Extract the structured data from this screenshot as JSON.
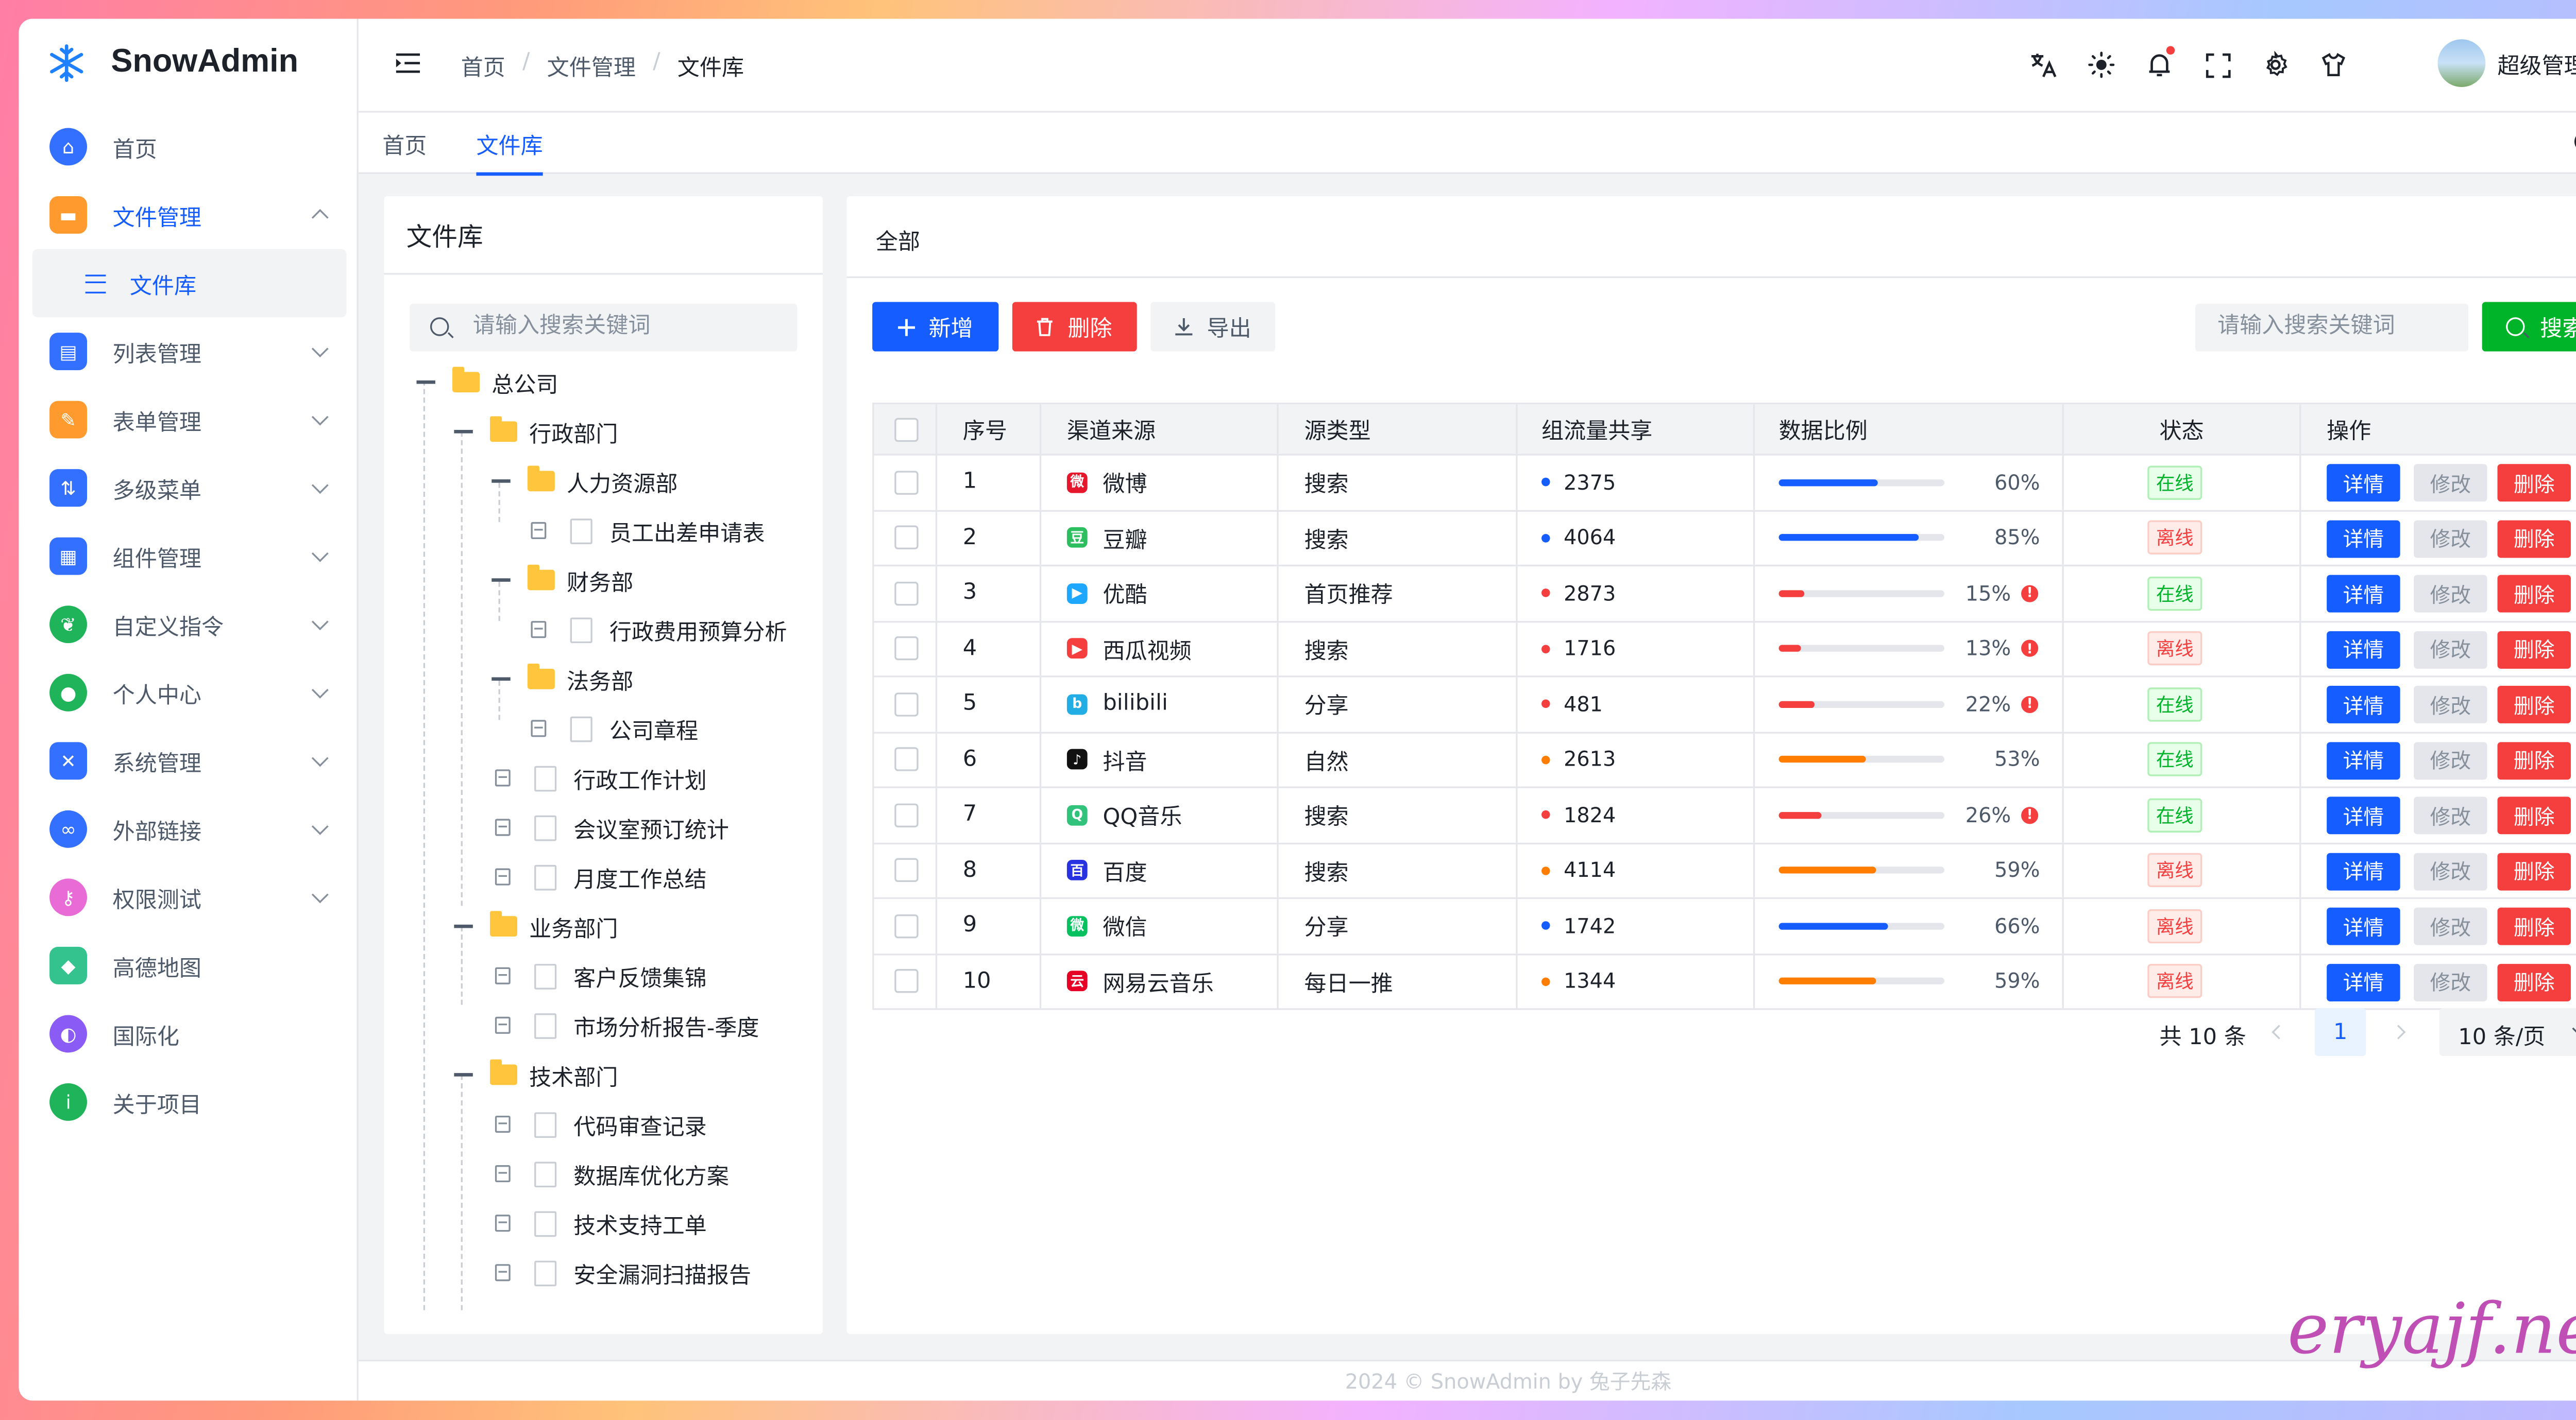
{
  "app": {
    "name": "SnowAdmin",
    "accent": "#165dff"
  },
  "sidebar": {
    "items": [
      {
        "label": "首页",
        "icon": "home-icon",
        "color": "#3370ff",
        "expandable": false
      },
      {
        "label": "文件管理",
        "icon": "folder-icon",
        "color": "#ff9a2e",
        "expandable": true,
        "expanded": true
      },
      {
        "label": "文件库",
        "icon": "menu-lines-icon",
        "sub": true
      },
      {
        "label": "列表管理",
        "icon": "clipboard-icon",
        "color": "#3370ff",
        "expandable": true
      },
      {
        "label": "表单管理",
        "icon": "form-icon",
        "color": "#ff9a2e",
        "expandable": true
      },
      {
        "label": "多级菜单",
        "icon": "sliders-icon",
        "color": "#3370ff",
        "expandable": true
      },
      {
        "label": "组件管理",
        "icon": "grid-icon",
        "color": "#3370ff",
        "expandable": true
      },
      {
        "label": "自定义指令",
        "icon": "leaf-icon",
        "color": "#1fb35a",
        "expandable": true
      },
      {
        "label": "个人中心",
        "icon": "user-icon",
        "color": "#1fb35a",
        "expandable": true
      },
      {
        "label": "系统管理",
        "icon": "tools-icon",
        "color": "#3370ff",
        "expandable": true
      },
      {
        "label": "外部链接",
        "icon": "link-icon",
        "color": "#3370ff",
        "expandable": true
      },
      {
        "label": "权限测试",
        "icon": "key-icon",
        "color": "#e86bd6",
        "expandable": true
      },
      {
        "label": "高德地图",
        "icon": "map-icon",
        "color": "#34c38f",
        "expandable": false
      },
      {
        "label": "国际化",
        "icon": "planet-icon",
        "color": "#8a5cf5",
        "expandable": false
      },
      {
        "label": "关于项目",
        "icon": "info-icon",
        "color": "#1fb35a",
        "expandable": false
      }
    ]
  },
  "header": {
    "breadcrumb": [
      "首页",
      "文件管理",
      "文件库"
    ],
    "user": "超级管理员",
    "icons": [
      "translate-icon",
      "sun-icon",
      "bell-icon",
      "fullscreen-icon",
      "settings-icon",
      "shirt-icon"
    ]
  },
  "tabs": {
    "items": [
      "首页",
      "文件库"
    ],
    "active": 1
  },
  "tree_panel": {
    "title": "文件库",
    "search_placeholder": "请输入搜索关键词",
    "nodes": [
      {
        "label": "总公司",
        "level": 0,
        "type": "folder"
      },
      {
        "label": "行政部门",
        "level": 1,
        "type": "folder"
      },
      {
        "label": "人力资源部",
        "level": 2,
        "type": "folder"
      },
      {
        "label": "员工出差申请表",
        "level": 3,
        "type": "file"
      },
      {
        "label": "财务部",
        "level": 2,
        "type": "folder"
      },
      {
        "label": "行政费用预算分析",
        "level": 3,
        "type": "file"
      },
      {
        "label": "法务部",
        "level": 2,
        "type": "folder"
      },
      {
        "label": "公司章程",
        "level": 3,
        "type": "file"
      },
      {
        "label": "行政工作计划",
        "level": 2,
        "type": "file"
      },
      {
        "label": "会议室预订统计",
        "level": 2,
        "type": "file"
      },
      {
        "label": "月度工作总结",
        "level": 2,
        "type": "file"
      },
      {
        "label": "业务部门",
        "level": 1,
        "type": "folder"
      },
      {
        "label": "客户反馈集锦",
        "level": 2,
        "type": "file"
      },
      {
        "label": "市场分析报告-季度",
        "level": 2,
        "type": "file"
      },
      {
        "label": "技术部门",
        "level": 1,
        "type": "folder"
      },
      {
        "label": "代码审查记录",
        "level": 2,
        "type": "file"
      },
      {
        "label": "数据库优化方案",
        "level": 2,
        "type": "file"
      },
      {
        "label": "技术支持工单",
        "level": 2,
        "type": "file"
      },
      {
        "label": "安全漏洞扫描报告",
        "level": 2,
        "type": "file"
      }
    ]
  },
  "content": {
    "title": "全部",
    "buttons": {
      "add": "新增",
      "delete": "删除",
      "export": "导出",
      "search": "搜索"
    },
    "search_placeholder": "请输入搜索关键词",
    "columns": [
      "序号",
      "渠道来源",
      "源类型",
      "组流量共享",
      "数据比例",
      "状态",
      "操作"
    ],
    "rows": [
      {
        "no": "1",
        "channel": "微博",
        "icon_color": "#e6162d",
        "glyph": "微",
        "type": "搜索",
        "traffic": "2375",
        "dot": "#165dff",
        "ratio": 60,
        "pct": "60%",
        "bar": "#165dff",
        "warn": false,
        "status": "在线",
        "online": true
      },
      {
        "no": "2",
        "channel": "豆瓣",
        "icon_color": "#2dbe60",
        "glyph": "豆",
        "type": "搜索",
        "traffic": "4064",
        "dot": "#165dff",
        "ratio": 85,
        "pct": "85%",
        "bar": "#165dff",
        "warn": false,
        "status": "离线",
        "online": false
      },
      {
        "no": "3",
        "channel": "优酷",
        "icon_color": "#1ea7ff",
        "glyph": "▶",
        "type": "首页推荐",
        "traffic": "2873",
        "dot": "#f53f3f",
        "ratio": 15,
        "pct": "15%",
        "bar": "#f53f3f",
        "warn": true,
        "status": "在线",
        "online": true
      },
      {
        "no": "4",
        "channel": "西瓜视频",
        "icon_color": "#f53f3f",
        "glyph": "▶",
        "type": "搜索",
        "traffic": "1716",
        "dot": "#f53f3f",
        "ratio": 13,
        "pct": "13%",
        "bar": "#f53f3f",
        "warn": true,
        "status": "离线",
        "online": false
      },
      {
        "no": "5",
        "channel": "bilibili",
        "icon_color": "#23ade5",
        "glyph": "b",
        "type": "分享",
        "traffic": "481",
        "dot": "#f53f3f",
        "ratio": 22,
        "pct": "22%",
        "bar": "#f53f3f",
        "warn": true,
        "status": "在线",
        "online": true
      },
      {
        "no": "6",
        "channel": "抖音",
        "icon_color": "#111111",
        "glyph": "♪",
        "type": "自然",
        "traffic": "2613",
        "dot": "#ff7d00",
        "ratio": 53,
        "pct": "53%",
        "bar": "#ff7d00",
        "warn": false,
        "status": "在线",
        "online": true
      },
      {
        "no": "7",
        "channel": "QQ音乐",
        "icon_color": "#31c27c",
        "glyph": "Q",
        "type": "搜索",
        "traffic": "1824",
        "dot": "#f53f3f",
        "ratio": 26,
        "pct": "26%",
        "bar": "#f53f3f",
        "warn": true,
        "status": "在线",
        "online": true
      },
      {
        "no": "8",
        "channel": "百度",
        "icon_color": "#2932e1",
        "glyph": "百",
        "type": "搜索",
        "traffic": "4114",
        "dot": "#ff7d00",
        "ratio": 59,
        "pct": "59%",
        "bar": "#ff7d00",
        "warn": false,
        "status": "离线",
        "online": false
      },
      {
        "no": "9",
        "channel": "微信",
        "icon_color": "#07c160",
        "glyph": "微",
        "type": "分享",
        "traffic": "1742",
        "dot": "#165dff",
        "ratio": 66,
        "pct": "66%",
        "bar": "#165dff",
        "warn": false,
        "status": "离线",
        "online": false
      },
      {
        "no": "10",
        "channel": "网易云音乐",
        "icon_color": "#e60026",
        "glyph": "云",
        "type": "每日一推",
        "traffic": "1344",
        "dot": "#ff7d00",
        "ratio": 59,
        "pct": "59%",
        "bar": "#ff7d00",
        "warn": false,
        "status": "离线",
        "online": false
      }
    ],
    "actions": {
      "detail": "详情",
      "edit": "修改",
      "delete": "删除"
    },
    "pagination": {
      "total": "共 10 条",
      "current": "1",
      "page_size": "10 条/页"
    }
  },
  "footer": "2024 © SnowAdmin by 兔子先森",
  "watermark": "eryajf.net"
}
